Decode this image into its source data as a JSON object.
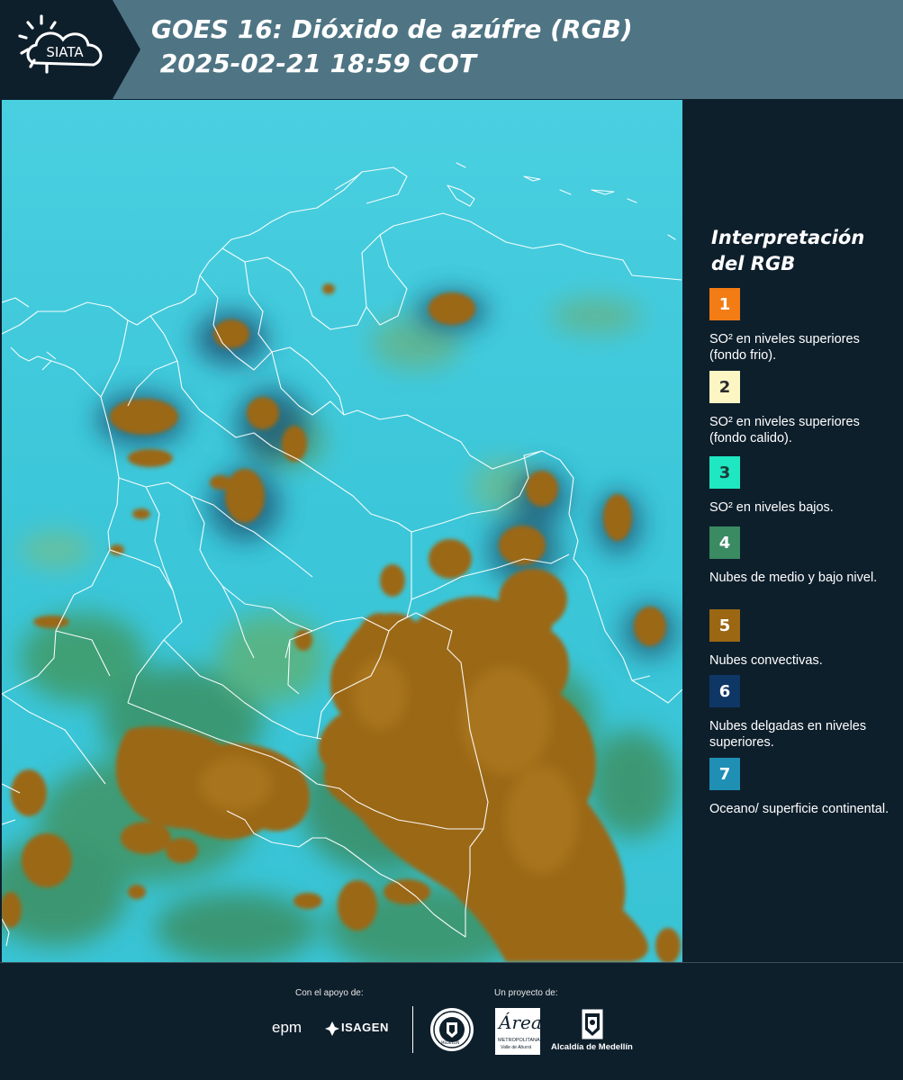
{
  "header": {
    "title_line1": "GOES 16: Dióxido de azúfre (RGB)",
    "title_line2": " 2025-02-21 18:59 COT",
    "logo_text": "SIATA"
  },
  "legend": {
    "title": "Interpretación del RGB",
    "items": [
      {
        "number": "1",
        "color": "#f47c14",
        "text_color": "#ffffff",
        "label": "SO² en niveles superiores (fondo frio)."
      },
      {
        "number": "2",
        "color": "#fcf5c4",
        "text_color": "#2a2a2a",
        "label": "SO² en niveles superiores (fondo calido)."
      },
      {
        "number": "3",
        "color": "#1fe7c2",
        "text_color": "#1b3b3b",
        "label": "SO² en niveles bajos."
      },
      {
        "number": "4",
        "color": "#3a8a62",
        "text_color": "#ffffff",
        "label": "Nubes de medio y bajo nivel."
      },
      {
        "number": "5",
        "color": "#9b6712",
        "text_color": "#ffffff",
        "label": "Nubes convectivas."
      },
      {
        "number": "6",
        "color": "#0f3766",
        "text_color": "#ffffff",
        "label": "Nubes delgadas en niveles superiores."
      },
      {
        "number": "7",
        "color": "#1f8fb4",
        "text_color": "#ffffff",
        "label": "Oceano/ superficie continental."
      }
    ]
  },
  "footer": {
    "support_label": "Con el apoyo de:",
    "project_label": "Un proyecto de:",
    "epm_text": "epm",
    "isagen_text": "ISAGEN",
    "seal_text": "MEDELLÍN",
    "area_text": "Área",
    "area_sub1": "METROPOLITANA",
    "area_sub2": "Valle de Aburrá",
    "alcaldia_text": "Alcaldía de Medellín"
  },
  "colors": {
    "header_bg": "#4f7584",
    "panel_bg": "#0e1f2c",
    "map_ocean": "#3ec8dc",
    "convective": "#9b6712",
    "midlow_cloud": "#3a8a62",
    "borders": "#ffffff"
  }
}
